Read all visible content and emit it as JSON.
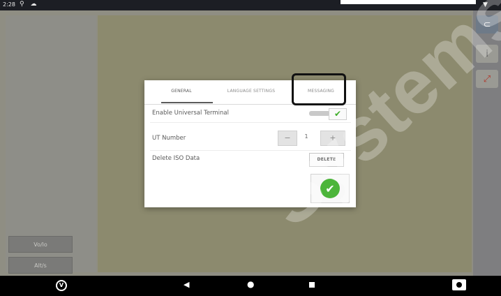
{
  "status_bar": {
    "time": "2:28",
    "icons": "⚲ ☁",
    "signal": "▼"
  },
  "side_panel": {
    "button_1": "Vo/lo",
    "button_2": "Alt/s"
  },
  "right_rail": {
    "icon_1": "⊂",
    "icon_2": "i",
    "icon_3": "⤢"
  },
  "dialog": {
    "tabs": [
      {
        "label": "GENERAL"
      },
      {
        "label": "LANGUAGE SETTINGS"
      },
      {
        "label": "MESSAGING"
      }
    ],
    "active_tab": "GENERAL",
    "rows": {
      "enable_ut_label": "Enable Universal Terminal",
      "ut_number_label": "UT Number",
      "ut_number_value": "1",
      "delete_iso_label": "Delete ISO Data"
    },
    "toggle_check": "✔",
    "stepper_minus": "−",
    "stepper_plus": "+",
    "delete_button": "DELETE",
    "ok_icon": "✔"
  },
  "watermark": "Systems",
  "nav_bar": {
    "logo": "V",
    "back": "◀",
    "home": "●"
  },
  "colors": {
    "accent_green": "#4cb53a",
    "dialog_bg": "#ffffff",
    "highlight_border": "#111111"
  }
}
